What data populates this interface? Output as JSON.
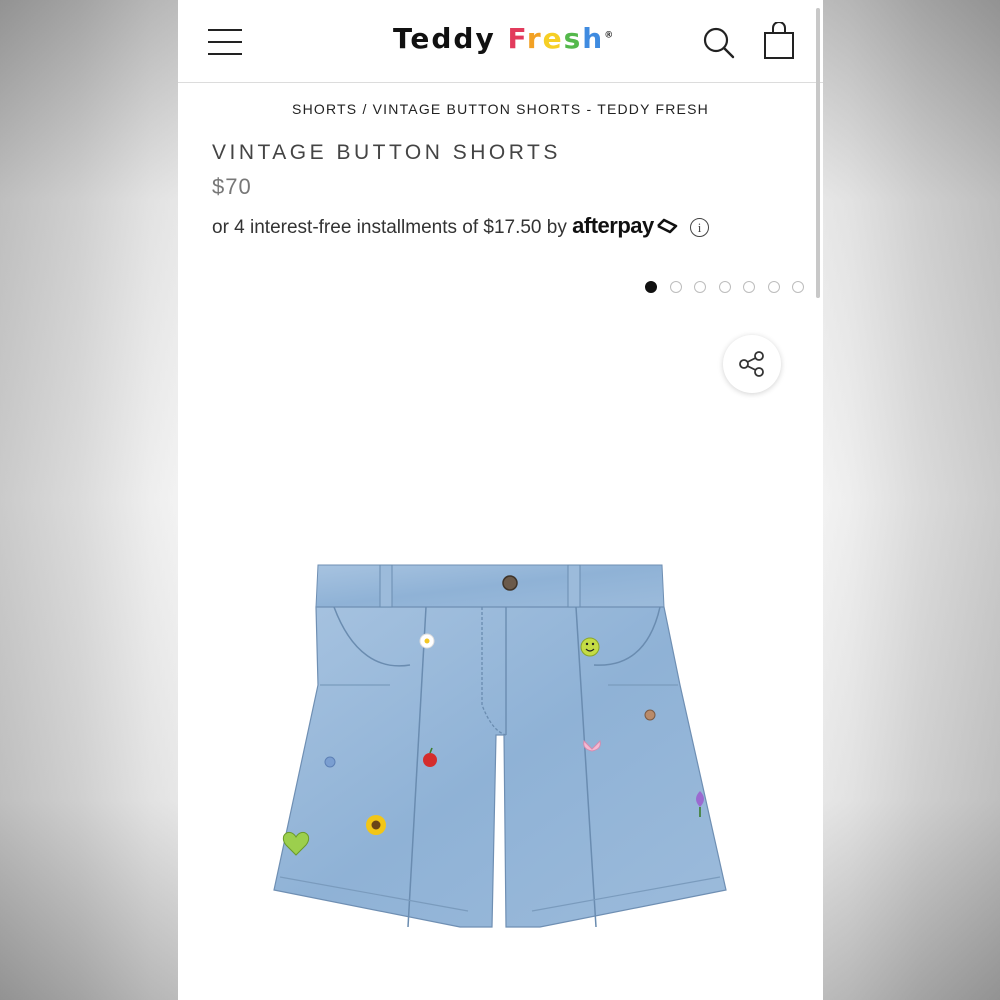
{
  "header": {
    "logo_teddy": "Teddy",
    "logo_fresh_letters": [
      "F",
      "r",
      "e",
      "s",
      "h"
    ],
    "logo_reg": "®"
  },
  "breadcrumb": {
    "category": "SHORTS",
    "separator": "/",
    "current": "VINTAGE BUTTON SHORTS - TEDDY FRESH"
  },
  "product": {
    "title": "VINTAGE BUTTON SHORTS",
    "price": "$70",
    "installments_prefix": "or 4 interest-free installments of $17.50 by",
    "afterpay": "afterpay",
    "info_glyph": "i",
    "image_count": 7,
    "active_image": 1
  },
  "icons": {
    "menu": "hamburger-menu-icon",
    "search": "search-icon",
    "cart": "shopping-bag-icon",
    "share": "share-icon",
    "info": "info-icon"
  },
  "colors": {
    "denim": "#8fb2d6",
    "text": "#222222",
    "logo_fresh": [
      "#e23b5c",
      "#f2a124",
      "#f6cf25",
      "#54b84b",
      "#3f8be0"
    ]
  }
}
